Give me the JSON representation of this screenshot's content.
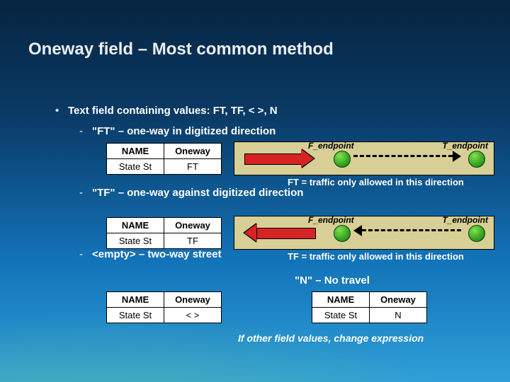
{
  "title": "Oneway field – Most common method",
  "bullet": "Text field containing values: FT, TF, < >, N",
  "sub1": "\"FT\" – one-way in digitized direction",
  "sub2": "\"TF\" – one-way against digitized direction",
  "sub3": "<empty> – two-way street",
  "sub4": "\"N\" – No travel",
  "hdr_name": "NAME",
  "hdr_oneway": "Oneway",
  "row_name": "State St",
  "val_ft": "FT",
  "val_tf": "TF",
  "val_empty": "< >",
  "val_n": "N",
  "flab": "F_endpoint",
  "tlab": "T_endpoint",
  "note_ft": "FT = traffic only allowed in this direction",
  "note_tf": "TF = traffic only allowed in this direction",
  "footer": "If other field values, change expression"
}
